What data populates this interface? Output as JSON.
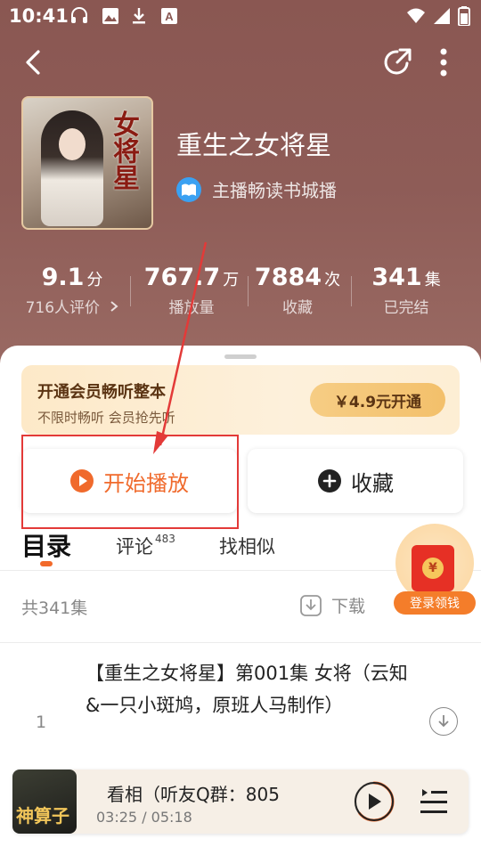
{
  "status_bar": {
    "time": "10:41"
  },
  "book": {
    "title": "重生之女将星",
    "anchor": "主播畅读书城播",
    "cover_art_text": "女将星"
  },
  "stats": [
    {
      "value": "9.1",
      "unit": "分",
      "label": "716人评价"
    },
    {
      "value": "767.7",
      "unit": "万",
      "label": "播放量"
    },
    {
      "value": "7884",
      "unit": "次",
      "label": "收藏"
    },
    {
      "value": "341",
      "unit": "集",
      "label": "已完结"
    }
  ],
  "vip": {
    "title": "开通会员畅听整本",
    "subtitle": "不限时畅听 会员抢先听",
    "button": "￥4.9元开通"
  },
  "actions": {
    "play": "开始播放",
    "favorite": "收藏"
  },
  "tabs": [
    {
      "label": "目录",
      "active": true
    },
    {
      "label": "评论",
      "badge": "483"
    },
    {
      "label": "找相似"
    }
  ],
  "catalog": {
    "count_text": "共341集",
    "download_label": "下载"
  },
  "promo": {
    "label": "登录领钱",
    "coin": "¥"
  },
  "episodes": [
    {
      "index": "1",
      "title": "【重生之女将星】第001集 女将（云知&一只小斑鸠，原班人马制作）"
    }
  ],
  "player": {
    "title": "看相（听友Q群：805",
    "time": "03:25 / 05:18",
    "cover_text": "神算子",
    "progress": 0.64
  },
  "colors": {
    "accent": "#f06a2c",
    "annotation": "#e33a38",
    "hero": "#8e5c57"
  }
}
